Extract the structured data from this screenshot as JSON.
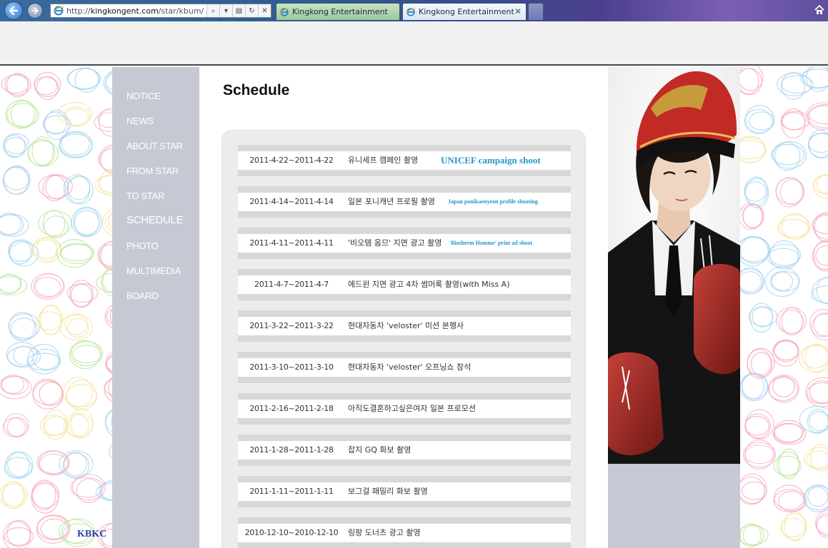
{
  "browser": {
    "address": {
      "prefix": "http://",
      "host": "kingkongent.com",
      "path": "/star/kbum/"
    },
    "tabs": [
      {
        "label": "Kingkong Entertainment"
      },
      {
        "label": "Kingkong Entertainment"
      }
    ]
  },
  "sidebar": {
    "items": [
      {
        "label": "NOTICE"
      },
      {
        "label": "NEWS"
      },
      {
        "label": "ABOUT STAR"
      },
      {
        "label": "FROM STAR"
      },
      {
        "label": "TO STAR"
      },
      {
        "label": "SCHEDULE"
      },
      {
        "label": "PHOTO"
      },
      {
        "label": "MULTIMEDIA"
      },
      {
        "label": "BOARD"
      }
    ],
    "active": "SCHEDULE"
  },
  "signature": "KBKC",
  "content": {
    "title": "Schedule",
    "schedule": [
      {
        "date": "2011-4-22~2011-4-22",
        "desc": "유니세프 캠페인 촬영",
        "note": "UNICEF campaign shoot"
      },
      {
        "date": "2011-4-14~2011-4-14",
        "desc": "일본 포니캐년 프로필 촬영",
        "note": "Japan ponikaenyeon profile shooting"
      },
      {
        "date": "2011-4-11~2011-4-11",
        "desc": "'비오템 옴므' 지면 광고 촬영",
        "note": "'Biotherm Homme' print ad shoot"
      },
      {
        "date": "2011-4-7~2011-4-7",
        "desc": "에드윈 지면 광고 4차 썸머룩 촬영(with Miss A)",
        "note": ""
      },
      {
        "date": "2011-3-22~2011-3-22",
        "desc": "현대자동차 'veloster' 미션 본행사",
        "note": ""
      },
      {
        "date": "2011-3-10~2011-3-10",
        "desc": "현대자동차 'veloster' 오프닝쇼 참석",
        "note": ""
      },
      {
        "date": "2011-2-16~2011-2-18",
        "desc": "아직도결혼하고싶은여자 일본 프로모션",
        "note": ""
      },
      {
        "date": "2011-1-28~2011-1-28",
        "desc": "잡지 GQ 화보 촬영",
        "note": ""
      },
      {
        "date": "2011-1-11~2011-1-11",
        "desc": "보그걸 패밀리 화보 촬영",
        "note": ""
      },
      {
        "date": "2010-12-10~2010-12-10",
        "desc": "링팡 도너츠 광고 촬영",
        "note": ""
      }
    ]
  },
  "colors": {
    "sidebar": "#c6c9d4",
    "note": "#2597c9",
    "signature": "#2d3fb0",
    "stripe": "#d8d8d8"
  }
}
